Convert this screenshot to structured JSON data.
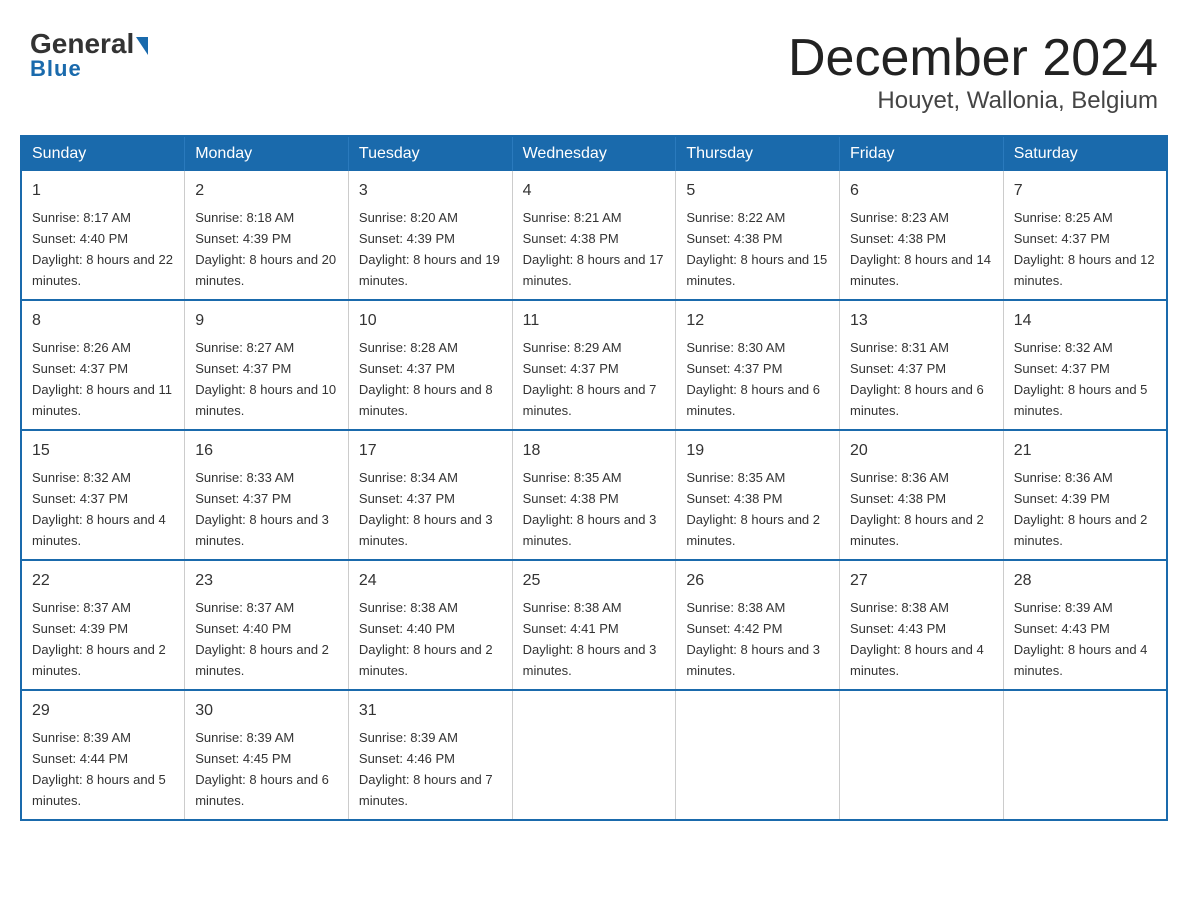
{
  "header": {
    "logo_main": "General",
    "logo_sub": "Blue",
    "month_title": "December 2024",
    "location": "Houyet, Wallonia, Belgium"
  },
  "calendar": {
    "days_of_week": [
      "Sunday",
      "Monday",
      "Tuesday",
      "Wednesday",
      "Thursday",
      "Friday",
      "Saturday"
    ],
    "weeks": [
      [
        {
          "day": "1",
          "sunrise": "8:17 AM",
          "sunset": "4:40 PM",
          "daylight": "8 hours and 22 minutes."
        },
        {
          "day": "2",
          "sunrise": "8:18 AM",
          "sunset": "4:39 PM",
          "daylight": "8 hours and 20 minutes."
        },
        {
          "day": "3",
          "sunrise": "8:20 AM",
          "sunset": "4:39 PM",
          "daylight": "8 hours and 19 minutes."
        },
        {
          "day": "4",
          "sunrise": "8:21 AM",
          "sunset": "4:38 PM",
          "daylight": "8 hours and 17 minutes."
        },
        {
          "day": "5",
          "sunrise": "8:22 AM",
          "sunset": "4:38 PM",
          "daylight": "8 hours and 15 minutes."
        },
        {
          "day": "6",
          "sunrise": "8:23 AM",
          "sunset": "4:38 PM",
          "daylight": "8 hours and 14 minutes."
        },
        {
          "day": "7",
          "sunrise": "8:25 AM",
          "sunset": "4:37 PM",
          "daylight": "8 hours and 12 minutes."
        }
      ],
      [
        {
          "day": "8",
          "sunrise": "8:26 AM",
          "sunset": "4:37 PM",
          "daylight": "8 hours and 11 minutes."
        },
        {
          "day": "9",
          "sunrise": "8:27 AM",
          "sunset": "4:37 PM",
          "daylight": "8 hours and 10 minutes."
        },
        {
          "day": "10",
          "sunrise": "8:28 AM",
          "sunset": "4:37 PM",
          "daylight": "8 hours and 8 minutes."
        },
        {
          "day": "11",
          "sunrise": "8:29 AM",
          "sunset": "4:37 PM",
          "daylight": "8 hours and 7 minutes."
        },
        {
          "day": "12",
          "sunrise": "8:30 AM",
          "sunset": "4:37 PM",
          "daylight": "8 hours and 6 minutes."
        },
        {
          "day": "13",
          "sunrise": "8:31 AM",
          "sunset": "4:37 PM",
          "daylight": "8 hours and 6 minutes."
        },
        {
          "day": "14",
          "sunrise": "8:32 AM",
          "sunset": "4:37 PM",
          "daylight": "8 hours and 5 minutes."
        }
      ],
      [
        {
          "day": "15",
          "sunrise": "8:32 AM",
          "sunset": "4:37 PM",
          "daylight": "8 hours and 4 minutes."
        },
        {
          "day": "16",
          "sunrise": "8:33 AM",
          "sunset": "4:37 PM",
          "daylight": "8 hours and 3 minutes."
        },
        {
          "day": "17",
          "sunrise": "8:34 AM",
          "sunset": "4:37 PM",
          "daylight": "8 hours and 3 minutes."
        },
        {
          "day": "18",
          "sunrise": "8:35 AM",
          "sunset": "4:38 PM",
          "daylight": "8 hours and 3 minutes."
        },
        {
          "day": "19",
          "sunrise": "8:35 AM",
          "sunset": "4:38 PM",
          "daylight": "8 hours and 2 minutes."
        },
        {
          "day": "20",
          "sunrise": "8:36 AM",
          "sunset": "4:38 PM",
          "daylight": "8 hours and 2 minutes."
        },
        {
          "day": "21",
          "sunrise": "8:36 AM",
          "sunset": "4:39 PM",
          "daylight": "8 hours and 2 minutes."
        }
      ],
      [
        {
          "day": "22",
          "sunrise": "8:37 AM",
          "sunset": "4:39 PM",
          "daylight": "8 hours and 2 minutes."
        },
        {
          "day": "23",
          "sunrise": "8:37 AM",
          "sunset": "4:40 PM",
          "daylight": "8 hours and 2 minutes."
        },
        {
          "day": "24",
          "sunrise": "8:38 AM",
          "sunset": "4:40 PM",
          "daylight": "8 hours and 2 minutes."
        },
        {
          "day": "25",
          "sunrise": "8:38 AM",
          "sunset": "4:41 PM",
          "daylight": "8 hours and 3 minutes."
        },
        {
          "day": "26",
          "sunrise": "8:38 AM",
          "sunset": "4:42 PM",
          "daylight": "8 hours and 3 minutes."
        },
        {
          "day": "27",
          "sunrise": "8:38 AM",
          "sunset": "4:43 PM",
          "daylight": "8 hours and 4 minutes."
        },
        {
          "day": "28",
          "sunrise": "8:39 AM",
          "sunset": "4:43 PM",
          "daylight": "8 hours and 4 minutes."
        }
      ],
      [
        {
          "day": "29",
          "sunrise": "8:39 AM",
          "sunset": "4:44 PM",
          "daylight": "8 hours and 5 minutes."
        },
        {
          "day": "30",
          "sunrise": "8:39 AM",
          "sunset": "4:45 PM",
          "daylight": "8 hours and 6 minutes."
        },
        {
          "day": "31",
          "sunrise": "8:39 AM",
          "sunset": "4:46 PM",
          "daylight": "8 hours and 7 minutes."
        },
        null,
        null,
        null,
        null
      ]
    ]
  }
}
